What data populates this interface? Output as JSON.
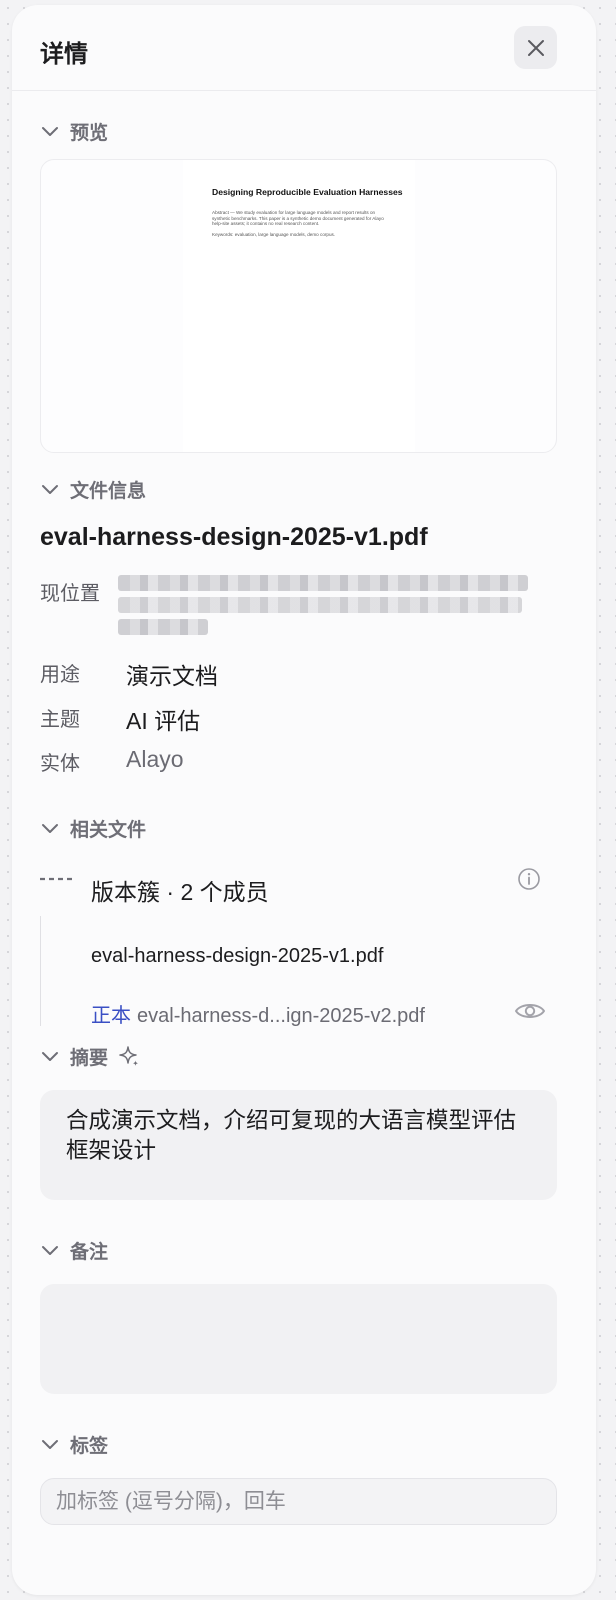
{
  "header": {
    "title": "详情",
    "close_icon": "close-icon"
  },
  "sections": {
    "preview": "预览",
    "file_info": "文件信息",
    "related": "相关文件",
    "summary": "摘要",
    "notes": "备注",
    "tags": "标签"
  },
  "preview": {
    "doc_title": "Designing Reproducible Evaluation Harnesses",
    "abstract": "Abstract — We study evaluation for large language models and report results on synthetic benchmarks. This paper is a synthetic demo document generated for Alayo help-site assets; it contains no real research content.",
    "keywords": "Keywords: evaluation, large language models, demo corpus."
  },
  "file_info": {
    "filename": "eval-harness-design-2025-v1.pdf",
    "location_label": "现位置",
    "purpose_label": "用途",
    "purpose_value": "演示文档",
    "topic_label": "主题",
    "topic_value": "AI 评估",
    "entity_label": "实体",
    "entity_value": "Alayo"
  },
  "related": {
    "cluster_label": "版本簇 · 2 个成员",
    "members": [
      {
        "name": "eval-harness-design-2025-v1.pdf"
      },
      {
        "tag": "正本",
        "name": "eval-harness-d...ign-2025-v2.pdf"
      }
    ]
  },
  "summary": {
    "text": "合成演示文档，介绍可复现的大语言模型评估框架设计"
  },
  "notes": {
    "value": ""
  },
  "tags": {
    "placeholder": "加标签 (逗号分隔)，回车"
  },
  "colors": {
    "accent": "#3a4fc4",
    "muted_text": "#6e6e76",
    "panel_bg": "#fbfbfc",
    "field_bg": "#f1f1f3"
  }
}
